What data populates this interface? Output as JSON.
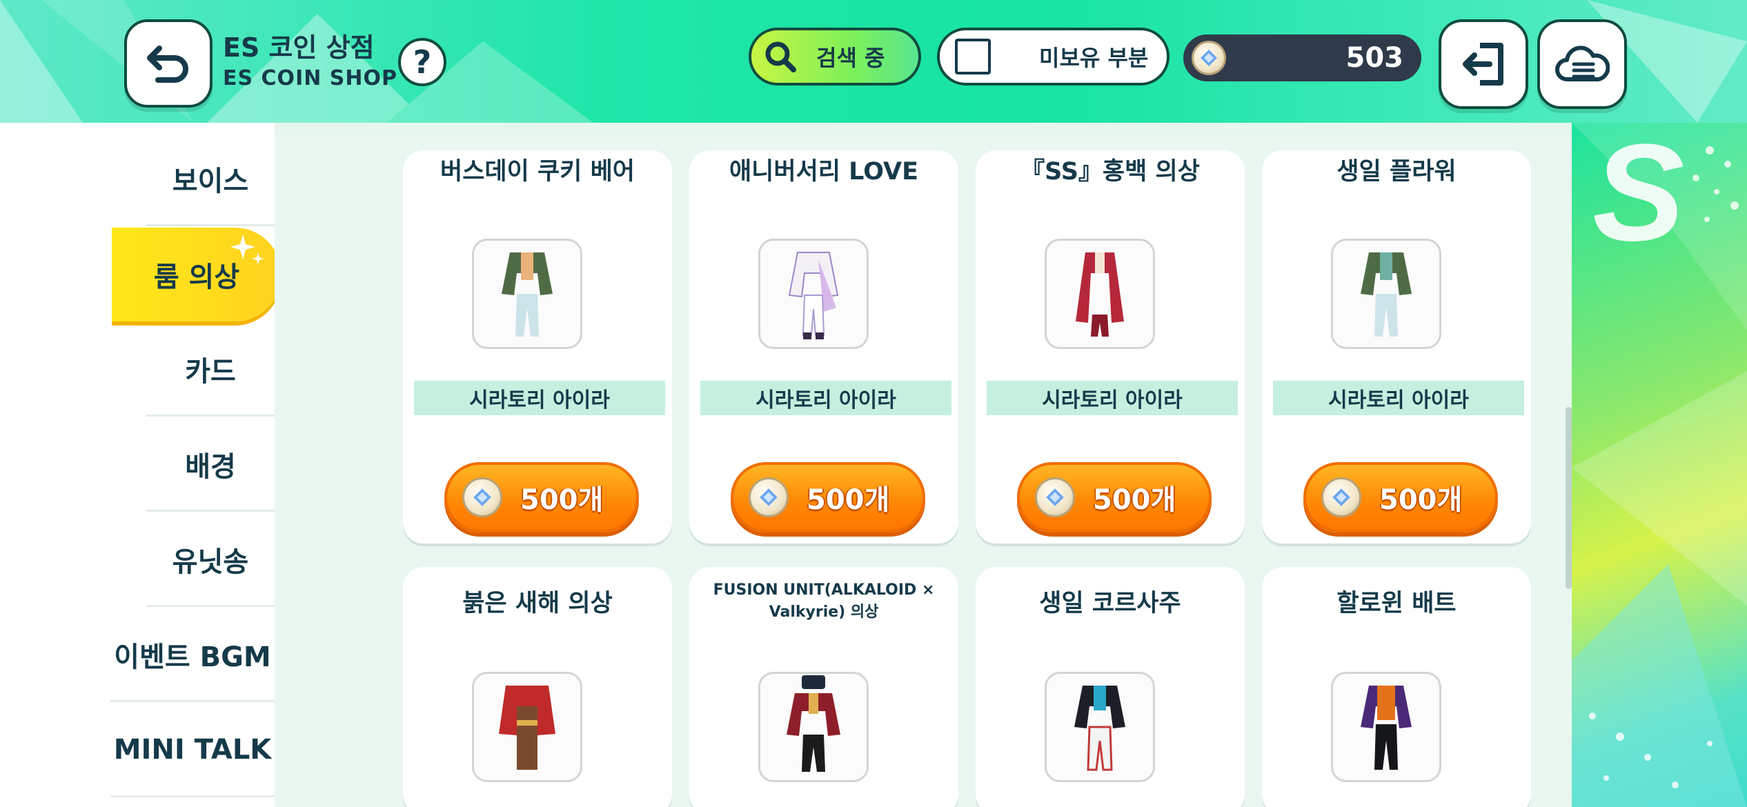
{
  "header": {
    "title": "ES 코인 상점",
    "subtitle": "ES COIN SHOP",
    "help_label": "?",
    "search_label": "검색 중",
    "filter_label": "미보유 부분",
    "coin_balance": "503",
    "icons": {
      "back": "back-arrow-icon",
      "search": "search-icon",
      "exit": "exit-icon",
      "menu": "cloud-menu-icon"
    }
  },
  "sidebar": {
    "items": [
      {
        "label": "보이스"
      },
      {
        "label": "룸 의상"
      },
      {
        "label": "카드"
      },
      {
        "label": "배경"
      },
      {
        "label": "유닛송"
      },
      {
        "label": "이벤트 BGM"
      },
      {
        "label": "MINI TALK"
      }
    ],
    "active_index": 1
  },
  "cards": [
    {
      "title": "버스데이 쿠키 베어",
      "owner": "시라토리 아이라",
      "price": "500개",
      "outfit": "green-jacket-outfit"
    },
    {
      "title": "애니버서리 LOVE",
      "owner": "시라토리 아이라",
      "price": "500개",
      "outfit": "white-purple-outfit"
    },
    {
      "title": "『SS』홍백 의상",
      "owner": "시라토리 아이라",
      "price": "500개",
      "outfit": "red-coat-outfit"
    },
    {
      "title": "생일 플라워",
      "owner": "시라토리 아이라",
      "price": "500개",
      "outfit": "green-jacket-outfit"
    },
    {
      "title": "붉은 새해 의상",
      "outfit": "red-kimono-outfit"
    },
    {
      "title": "FUSION UNIT(ALKALOID × Valkyrie) 의상",
      "outfit": "military-red-outfit"
    },
    {
      "title": "생일 코르사주",
      "outfit": "black-white-outfit"
    },
    {
      "title": "할로윈 배트",
      "outfit": "purple-orange-outfit"
    }
  ],
  "colors": {
    "header_accent": "#1fe6a8",
    "active_tab": "#ffe81a",
    "buy_button": "#ff8a06",
    "text_dark": "#153a4a"
  }
}
